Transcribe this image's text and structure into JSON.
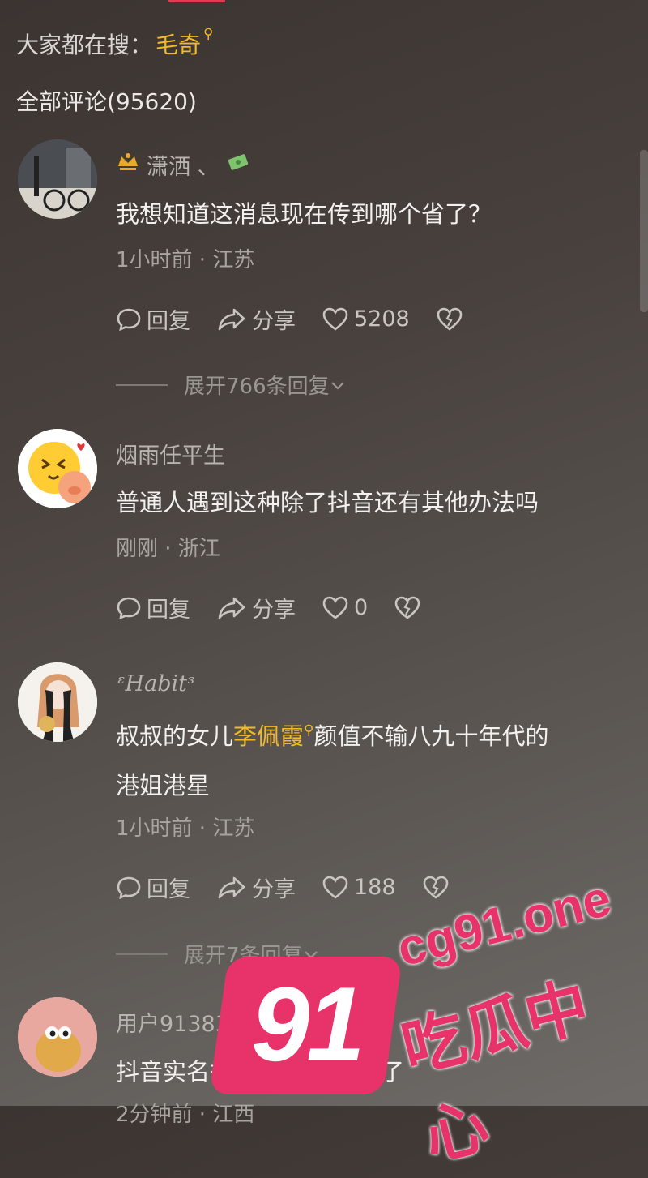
{
  "search": {
    "prefix": "大家都在搜：",
    "keyword": "毛奇"
  },
  "comments_header": "全部评论(95620)",
  "comments": [
    {
      "username": "潇洒 、",
      "text": "我想知道这消息现在传到哪个省了？",
      "meta": "1小时前 · 江苏",
      "reply_label": "回复",
      "share_label": "分享",
      "likes": "5208",
      "expand": "展开766条回复"
    },
    {
      "username": "烟雨任平生",
      "text": "普通人遇到这种除了抖音还有其他办法吗",
      "meta": "刚刚 · 浙江",
      "reply_label": "回复",
      "share_label": "分享",
      "likes": "0"
    },
    {
      "username": "ᵋHabitᵌ",
      "text_before": "叔叔的女儿",
      "text_highlight": "李佩霞",
      "text_after": "颜值不输八九十年代的",
      "text_line2": "港姐港星",
      "meta": "1小时前 · 江苏",
      "reply_label": "回复",
      "share_label": "分享",
      "likes": "188",
      "expand": "展开7条回复"
    },
    {
      "username": "用户9138331547619",
      "text": "抖音实名举报比报j有用多了",
      "meta": "2分钟前 · 江西"
    }
  ],
  "watermark": {
    "number": "91",
    "url": "cg91.one",
    "name": "吃瓜中心"
  },
  "colors": {
    "accent": "#f2b928",
    "watermark": "#e8336a"
  }
}
